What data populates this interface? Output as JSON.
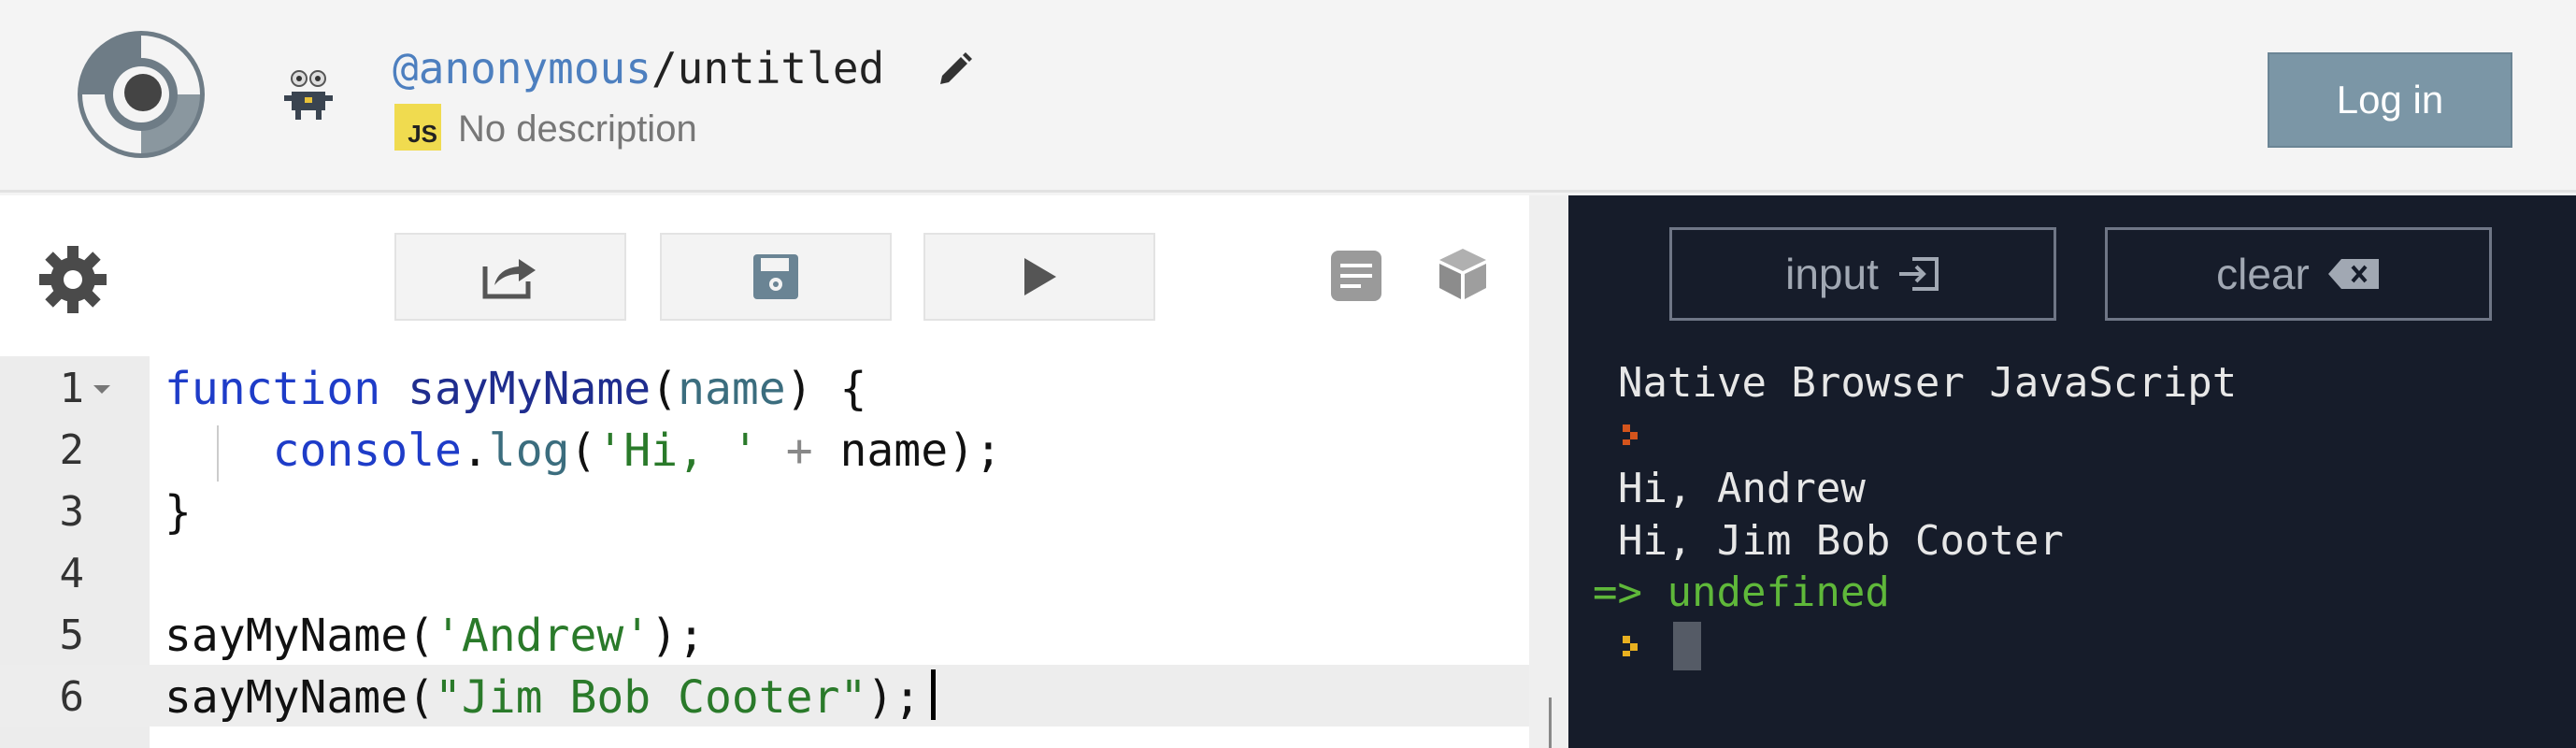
{
  "header": {
    "owner": "@anonymous",
    "separator": "/",
    "repl_name": "untitled",
    "language_badge": "JS",
    "description": "No description",
    "login_label": "Log in"
  },
  "editor": {
    "line_numbers": [
      "1",
      "2",
      "3",
      "4",
      "5",
      "6"
    ],
    "lines": {
      "l1": {
        "kw": "function",
        "sp1": " ",
        "fn": "sayMyName",
        "p1": "(",
        "param": "name",
        "p2": ") {"
      },
      "l2": {
        "indent": "    ",
        "obj": "console",
        "dot": ".",
        "method": "log",
        "p1": "(",
        "str": "'Hi, '",
        "sp": " ",
        "op": "+",
        "rest": " name);"
      },
      "l3": {
        "text": "}"
      },
      "l5": {
        "fn": "sayMyName(",
        "str": "'Andrew'",
        "rest": ");"
      },
      "l6": {
        "fn": "sayMyName(",
        "str": "\"Jim Bob Cooter\"",
        "rest": ");"
      }
    }
  },
  "console": {
    "input_label": "input",
    "clear_label": "clear",
    "header_text": "Native Browser JavaScript",
    "output_lines": [
      "Hi, Andrew",
      "Hi, Jim Bob Cooter"
    ],
    "result_arrow": "=>",
    "result_value": "undefined"
  },
  "colors": {
    "accent_login": "#7b96a6",
    "console_bg": "#161c2a",
    "result_green": "#5fb83a",
    "js_badge": "#f0db4f"
  },
  "icons": [
    "logo-icon",
    "robot-avatar-icon",
    "pencil-icon",
    "gear-icon",
    "share-icon",
    "save-icon",
    "play-icon",
    "format-icon",
    "packages-icon",
    "input-icon",
    "clear-icon",
    "prompt-icon"
  ]
}
